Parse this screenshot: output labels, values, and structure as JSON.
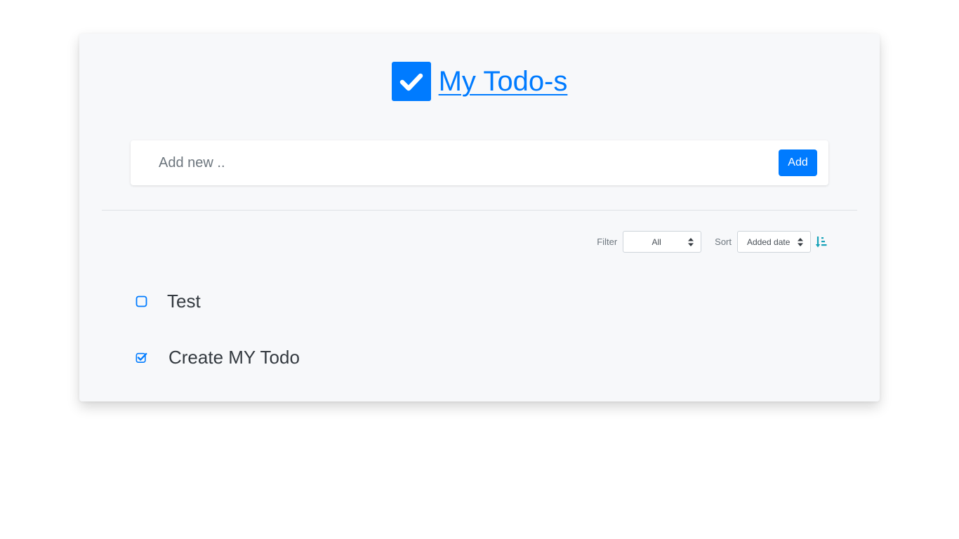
{
  "header": {
    "title": "My Todo-s"
  },
  "add_form": {
    "placeholder": "Add new ..",
    "value": "",
    "button_label": "Add"
  },
  "controls": {
    "filter_label": "Filter",
    "filter_value": "All",
    "sort_label": "Sort",
    "sort_value": "Added date",
    "sort_direction_icon": "sort-amount-down-icon"
  },
  "todos": [
    {
      "text": "Test",
      "completed": false
    },
    {
      "text": "Create MY Todo",
      "completed": true
    }
  ],
  "colors": {
    "accent": "#007bff",
    "card_background": "#f7f8fa",
    "sort_icon": "#17a2b8",
    "text": "#343a40",
    "muted": "#6c757d"
  }
}
